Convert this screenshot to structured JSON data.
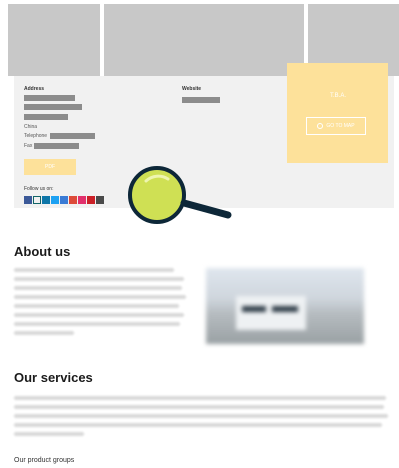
{
  "contact": {
    "address_label": "Address",
    "website_label": "Website",
    "country": "China",
    "telephone_label": "Telephone",
    "fax_label": "Fax",
    "pdf_button": "PDF",
    "follow_label": "Follow us on:",
    "booth_label": "T.B.A.",
    "map_button": "GO TO MAP"
  },
  "about": {
    "heading": "About us"
  },
  "services": {
    "heading": "Our services",
    "product_groups": "Our product groups"
  },
  "colors": {
    "accent_yellow": "#fde19a",
    "magnifier_lens": "#cfe054",
    "magnifier_ring": "#0d2738"
  },
  "icons": [
    "facebook-icon",
    "xing-icon",
    "linkedin-icon",
    "twitter-icon",
    "youtube-icon",
    "google-plus-icon",
    "instagram-icon",
    "pinterest-icon",
    "vk-icon"
  ]
}
